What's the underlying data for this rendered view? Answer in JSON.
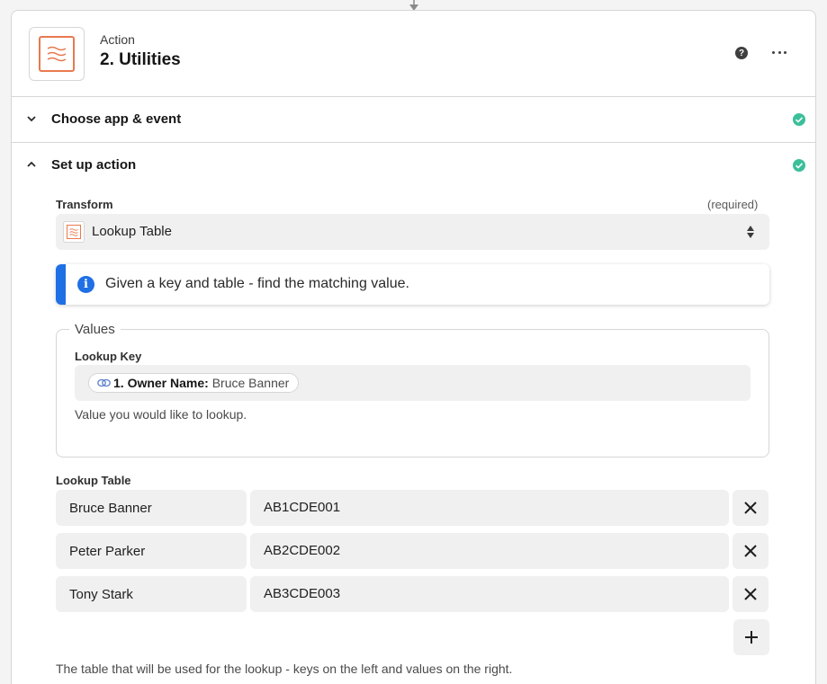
{
  "header": {
    "subtitle": "Action",
    "title": "2. Utilities",
    "help_icon": "question-circle-icon",
    "more_icon": "ellipsis-icon"
  },
  "sections": {
    "choose": {
      "label": "Choose app & event",
      "status": "complete"
    },
    "setup": {
      "label": "Set up action",
      "status": "complete"
    }
  },
  "transform": {
    "label": "Transform",
    "required": "(required)",
    "value": "Lookup Table"
  },
  "info": {
    "text": "Given a key and table - find the matching value."
  },
  "values": {
    "legend": "Values",
    "lookup_key_label": "Lookup Key",
    "pill_step": "1. Owner Name:",
    "pill_value": "Bruce Banner",
    "help": "Value you would like to lookup."
  },
  "lookup_table": {
    "label": "Lookup Table",
    "rows": [
      {
        "key": "Bruce Banner",
        "value": "AB1CDE001"
      },
      {
        "key": "Peter Parker",
        "value": "AB2CDE002"
      },
      {
        "key": "Tony Stark",
        "value": "AB3CDE003"
      }
    ],
    "help": "The table that will be used for the lookup - keys on the left and values on the right."
  },
  "colors": {
    "accent_orange": "#e8794f",
    "info_blue": "#1f6fe5",
    "check_green": "#3bbf9a"
  }
}
